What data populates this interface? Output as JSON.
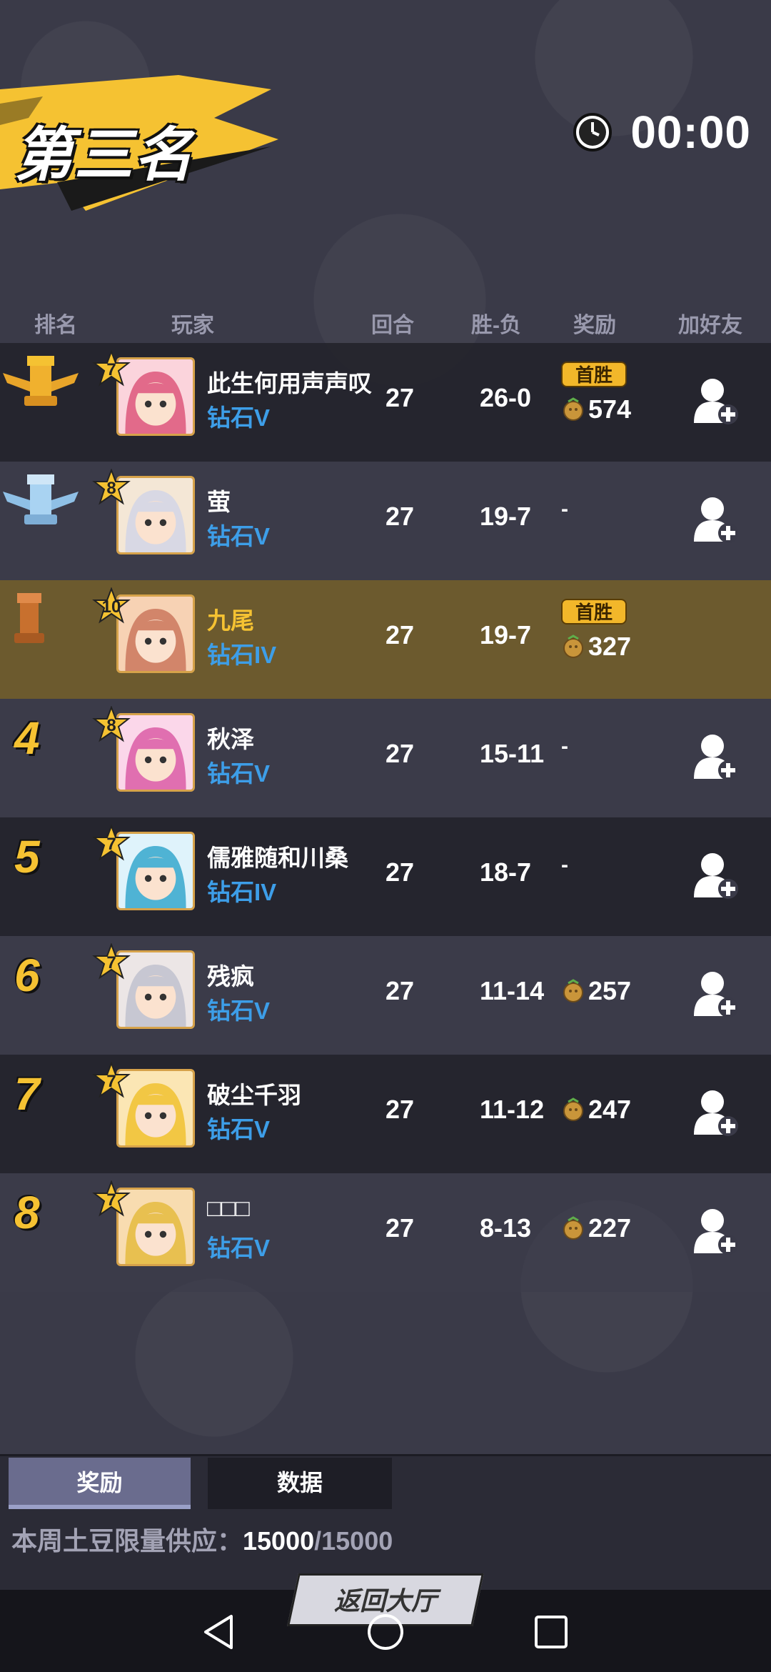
{
  "header": {
    "rank_title": "第三名",
    "timer": "00:00"
  },
  "columns": {
    "rank": "排名",
    "player": "玩家",
    "rounds": "回合",
    "win_loss": "胜-负",
    "reward": "奖励",
    "add_friend": "加好友"
  },
  "rows": [
    {
      "rank": "1",
      "rank_icon": "gold-rook-trophy-icon",
      "level": "7",
      "name": "此生何用声声叹",
      "tier": "钻石V",
      "rounds": "27",
      "win_loss": "26-0",
      "first_win": "首胜",
      "reward": "574",
      "add_friend": true
    },
    {
      "rank": "2",
      "rank_icon": "silver-rook-trophy-icon",
      "level": "8",
      "name": "萤",
      "tier": "钻石V",
      "rounds": "27",
      "win_loss": "19-7",
      "first_win": "",
      "reward": "-",
      "add_friend": true
    },
    {
      "rank": "3",
      "rank_icon": "bronze-rook-icon",
      "level": "10",
      "name": "九尾",
      "tier": "钻石IV",
      "rounds": "27",
      "win_loss": "19-7",
      "first_win": "首胜",
      "reward": "327",
      "add_friend": false
    },
    {
      "rank": "4",
      "rank_icon": "",
      "level": "8",
      "name": "秋泽",
      "tier": "钻石V",
      "rounds": "27",
      "win_loss": "15-11",
      "first_win": "",
      "reward": "-",
      "add_friend": true
    },
    {
      "rank": "5",
      "rank_icon": "",
      "level": "7",
      "name": "儒雅随和川桑",
      "tier": "钻石IV",
      "rounds": "27",
      "win_loss": "18-7",
      "first_win": "",
      "reward": "-",
      "add_friend": true
    },
    {
      "rank": "6",
      "rank_icon": "",
      "level": "7",
      "name": "残疯",
      "tier": "钻石V",
      "rounds": "27",
      "win_loss": "11-14",
      "first_win": "",
      "reward": "257",
      "add_friend": true
    },
    {
      "rank": "7",
      "rank_icon": "",
      "level": "7",
      "name": "破尘千羽",
      "tier": "钻石V",
      "rounds": "27",
      "win_loss": "11-12",
      "first_win": "",
      "reward": "247",
      "add_friend": true
    },
    {
      "rank": "8",
      "rank_icon": "",
      "level": "7",
      "name": "□□□",
      "tier": "钻石V",
      "rounds": "27",
      "win_loss": "8-13",
      "first_win": "",
      "reward": "227",
      "add_friend": true
    }
  ],
  "tabs": {
    "reward": "奖励",
    "data": "数据"
  },
  "supply": {
    "label": "本周土豆限量供应：",
    "current": "15000",
    "total": "/15000"
  },
  "buttons": {
    "return_lobby": "返回大厅"
  },
  "colors": {
    "accent_gold": "#f5c232",
    "tier_blue": "#3d9ee8",
    "my_row": "#6c5a2e"
  }
}
